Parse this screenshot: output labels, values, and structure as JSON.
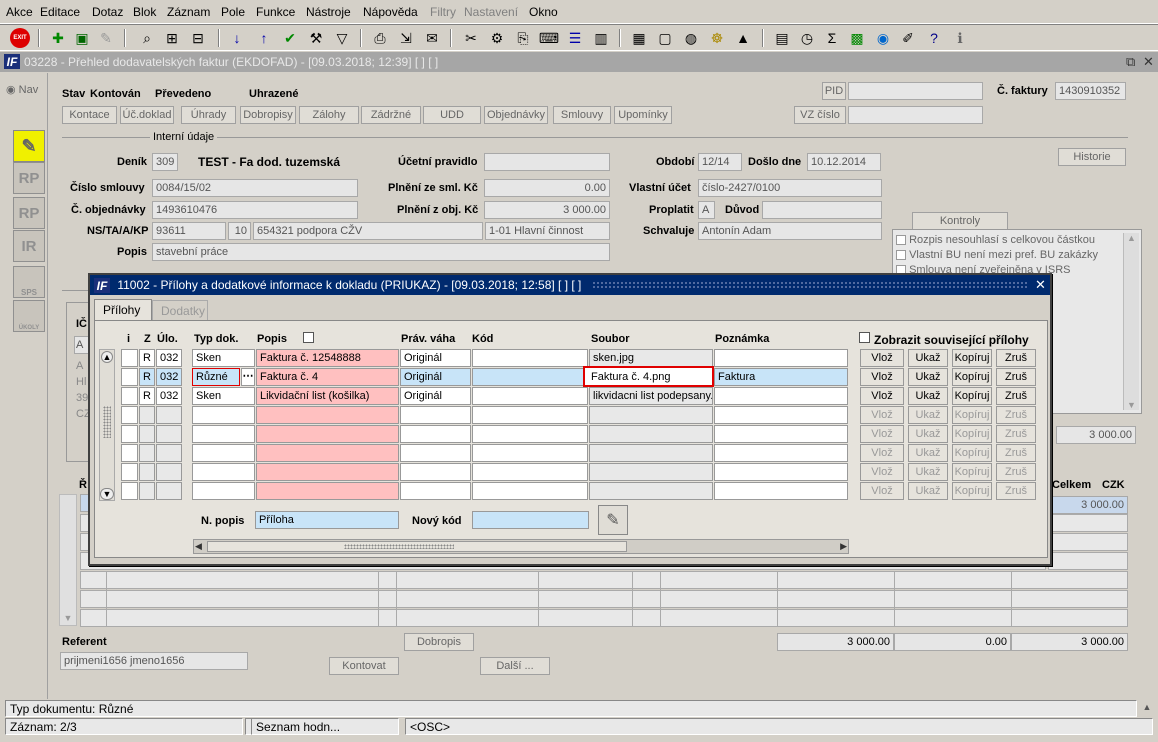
{
  "menu": [
    "Akce",
    "Editace",
    "Dotaz",
    "Blok",
    "Záznam",
    "Pole",
    "Funkce",
    "Nástroje",
    "Nápověda",
    "Filtry",
    "Nastavení",
    "Okno"
  ],
  "toolbar": {
    "exit_label": "EXIT"
  },
  "mdi": {
    "title": "03228 - Přehled dodavatelských faktur (EKDOFAD) - [09.03.2018; 12:39]  [ ]  [ ]",
    "restore": "⧉",
    "close": "✕"
  },
  "left": {
    "nav": "Nav",
    "rp1": "RP",
    "rp2": "RP",
    "ir": "IR",
    "sps": "SPS",
    "ukoly": "ÚKOLY"
  },
  "header": {
    "stav_label": "Stav",
    "stav_value": "Kontován",
    "prevedeno": "Převedeno",
    "uhrazene": "Uhrazené",
    "pid_label": "PID",
    "pid_value": "",
    "faktura_label": "Č. faktury",
    "faktura_value": "1430910352",
    "vz_label": "VZ číslo",
    "vz_value": ""
  },
  "buttons": [
    "Kontace",
    "Úč.doklad",
    "Úhrady",
    "Dobropisy",
    "Zálohy",
    "Zádržné",
    "UDD",
    "Objednávky",
    "Smlouvy",
    "Upomínky"
  ],
  "interni": "Interní údaje",
  "form": {
    "denik_label": "Deník",
    "denik_value": "309",
    "denik_name": "TEST - Fa dod. tuzemská",
    "ucetni_label": "Účetní pravidlo",
    "ucetni_value": "",
    "obdobi_label": "Období",
    "obdobi_value": "12/14",
    "doslo_label": "Došlo dne",
    "doslo_value": "10.12.2014",
    "historie": "Historie",
    "smlouvy_label": "Číslo smlouvy",
    "smlouvy_value": "0084/15/02",
    "plneni_sml_label": "Plnění ze sml. Kč",
    "plneni_sml_value": "0.00",
    "vlastni_label": "Vlastní účet",
    "vlastni_value": "číslo-2427/0100",
    "objednavky_label": "Č. objednávky",
    "objednavky_value": "1493610476",
    "plneni_obj_label": "Plnění z obj. Kč",
    "plneni_obj_value": "3 000.00",
    "proplatit_label": "Proplatit",
    "proplatit_value": "A",
    "duvod_label": "Důvod",
    "duvod_value": "",
    "ns_label": "NS/TA/A/KP",
    "ns1": "93611",
    "ns2": "10",
    "ns3": "654321 podpora CŽV",
    "ns4": "1-01 Hlavní činnost",
    "schvaluje_label": "Schvaluje",
    "schvaluje_value": "Antonín Adam",
    "popis_label": "Popis",
    "popis_value": "stavební práce"
  },
  "kontroly": {
    "title": "Kontroly",
    "items": [
      "Rozpis nesouhlasí s celkovou částkou",
      "Vlastní BU není mezi pref. BU zakázky",
      "Smlouva není zveřejněna v ISRS"
    ]
  },
  "right": {
    "amount1": "3 000.00",
    "celkem": "Celkem",
    "czk": "CZK",
    "amount2": "3 000.00"
  },
  "bottom": {
    "referent_label": "Referent",
    "referent_value": "prijmeni1656 jmeno1656",
    "dobropis": "Dobropis",
    "kontovat": "Kontovat",
    "dalsi": "Další ...",
    "sum1": "3 000.00",
    "sum2": "0.00",
    "sum3": "3 000.00"
  },
  "bg_partial": {
    "ic": "IČ",
    "r": "Ř",
    "a": "A",
    "a2": "A",
    "hl": "Hl",
    "n39": "39",
    "cz": "CZ"
  },
  "dialog": {
    "title": "11002 - Přílohy a dodatkové informace k dokladu (PRIUKAZ) - [09.03.2018; 12:58]  [ ]  [ ]",
    "close": "✕",
    "tabs": [
      "Přílohy",
      "Dodatky"
    ],
    "headers": {
      "i": "i",
      "z": "Z",
      "ulo": "Úlo.",
      "typ": "Typ dok.",
      "popis": "Popis",
      "prav": "Práv. váha",
      "kod": "Kód",
      "soubor": "Soubor",
      "poznamka": "Poznámka",
      "zobrazit": "Zobrazit související přílohy"
    },
    "rows": [
      {
        "z": "R",
        "ulo": "032",
        "typ": "Sken",
        "popis": "Faktura č. 12548888",
        "prav": "Originál",
        "kod": "",
        "soubor": "sken.jpg",
        "poznamka": ""
      },
      {
        "z": "R",
        "ulo": "032",
        "typ": "Různé",
        "popis": "Faktura č. 4",
        "prav": "Originál",
        "kod": "",
        "soubor": "Faktura č. 4.png",
        "poznamka": "Faktura"
      },
      {
        "z": "R",
        "ulo": "032",
        "typ": "Sken",
        "popis": "Likvidační list (košilka)",
        "prav": "Originál",
        "kod": "",
        "soubor": "likvidacni list podepsany.",
        "poznamka": ""
      }
    ],
    "row_buttons": [
      "Vlož",
      "Ukaž",
      "Kopíruj",
      "Zruš"
    ],
    "npopis_label": "N. popis",
    "npopis_value": "Příloha",
    "novykod_label": "Nový kód",
    "novykod_value": "",
    "highlight_color": "#e00000"
  },
  "status": {
    "typ": "Typ dokumentu: Různé",
    "zaznam": "Záznam: 2/3",
    "seznam": "Seznam hodn...",
    "osc": "<OSC>"
  }
}
